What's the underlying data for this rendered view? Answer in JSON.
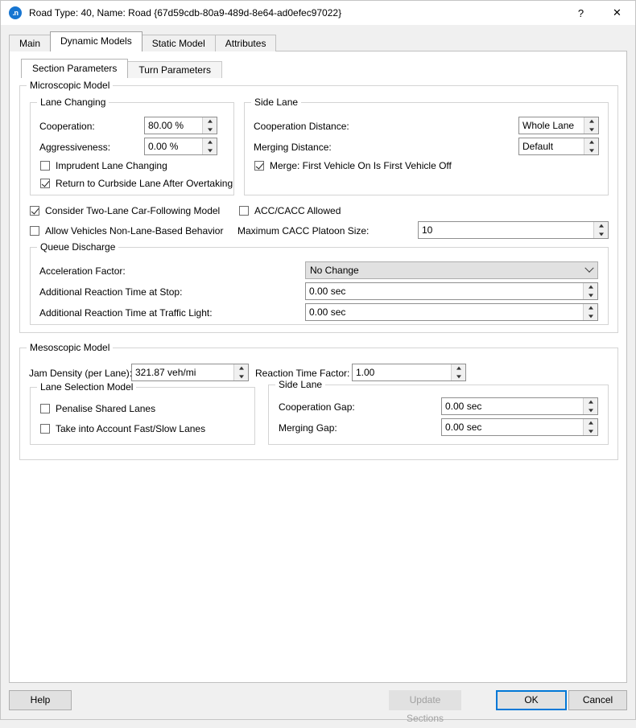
{
  "window": {
    "icon": "aimsun-n-icon",
    "title": "Road Type: 40, Name: Road  {67d59cdb-80a9-489d-8e64-ad0efec97022}",
    "help_glyph": "?",
    "close_glyph": "✕"
  },
  "tabs": [
    {
      "label": "Main",
      "selected": false
    },
    {
      "label": "Dynamic Models",
      "selected": true
    },
    {
      "label": "Static Model",
      "selected": false
    },
    {
      "label": "Attributes",
      "selected": false
    }
  ],
  "inner_tabs": [
    {
      "label": "Section Parameters",
      "selected": true
    },
    {
      "label": "Turn Parameters",
      "selected": false
    }
  ],
  "microscopic": {
    "legend": "Microscopic Model",
    "lane_changing": {
      "legend": "Lane Changing",
      "cooperation_label": "Cooperation:",
      "cooperation_value": "80.00 %",
      "aggressiveness_label": "Aggressiveness:",
      "aggressiveness_value": "0.00 %",
      "imprudent_label": "Imprudent Lane Changing",
      "imprudent_checked": false,
      "return_curbside_label": "Return to Curbside Lane After Overtaking",
      "return_curbside_checked": true
    },
    "side_lane": {
      "legend": "Side Lane",
      "cooperation_distance_label": "Cooperation Distance:",
      "cooperation_distance_value": "Whole Lane",
      "merging_distance_label": "Merging Distance:",
      "merging_distance_value": "Default",
      "merge_first_label": "Merge: First Vehicle On Is First Vehicle Off",
      "merge_first_checked": true
    },
    "two_lane_label": "Consider Two-Lane Car-Following Model",
    "two_lane_checked": true,
    "non_lane_based_label": "Allow Vehicles Non-Lane-Based Behavior",
    "non_lane_based_checked": false,
    "acc_cacc_label": "ACC/CACC Allowed",
    "acc_cacc_checked": false,
    "max_platoon_label": "Maximum CACC Platoon Size:",
    "max_platoon_value": "10",
    "queue_discharge": {
      "legend": "Queue Discharge",
      "acceleration_factor_label": "Acceleration Factor:",
      "acceleration_factor_value": "No Change",
      "reaction_stop_label": "Additional Reaction Time at Stop:",
      "reaction_stop_value": "0.00 sec",
      "reaction_light_label": "Additional Reaction Time at Traffic Light:",
      "reaction_light_value": "0.00 sec"
    }
  },
  "mesoscopic": {
    "legend": "Mesoscopic Model",
    "jam_density_label": "Jam Density (per Lane):",
    "jam_density_value": "321.87 veh/mi",
    "reaction_time_factor_label": "Reaction Time Factor:",
    "reaction_time_factor_value": "1.00",
    "lane_selection": {
      "legend": "Lane Selection Model",
      "penalise_label": "Penalise Shared Lanes",
      "penalise_checked": false,
      "fast_slow_label": "Take into Account Fast/Slow Lanes",
      "fast_slow_checked": false
    },
    "side_lane": {
      "legend": "Side Lane",
      "cooperation_gap_label": "Cooperation Gap:",
      "cooperation_gap_value": "0.00 sec",
      "merging_gap_label": "Merging Gap:",
      "merging_gap_value": "0.00 sec"
    }
  },
  "buttons": {
    "help": "Help",
    "update_sections": "Update Sections",
    "ok": "OK",
    "cancel": "Cancel"
  },
  "colors": {
    "accent": "#0078d7",
    "icon_blue": "#1675d1",
    "dialog_bg": "#f0f0f0",
    "panel_bg": "#ffffff",
    "control_bg": "#e1e1e1"
  }
}
